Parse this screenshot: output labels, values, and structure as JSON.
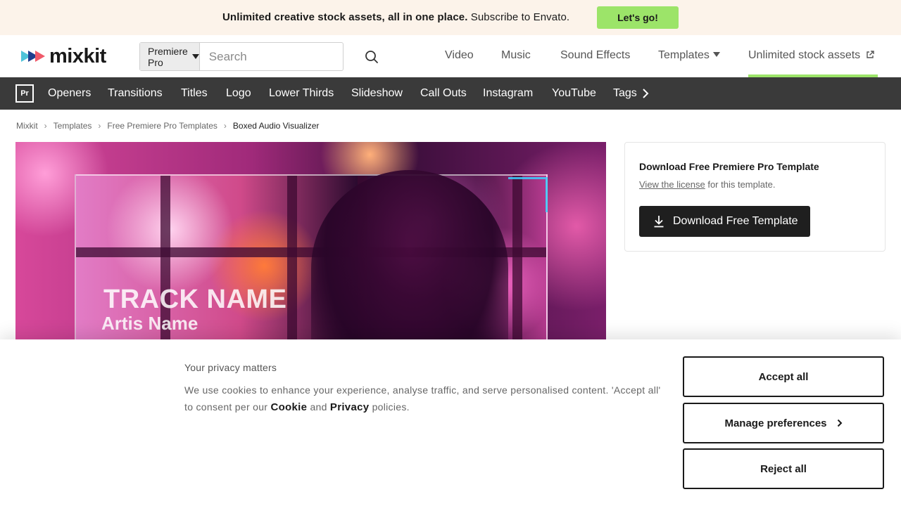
{
  "promo": {
    "bold_text": "Unlimited creative stock assets, all in one place.",
    "text": " Subscribe to Envato.",
    "button_label": "Let's go!"
  },
  "header": {
    "logo_text": "mixkit",
    "search": {
      "category_selected": "Premiere Pro",
      "placeholder": "Search"
    },
    "nav": {
      "video": "Video",
      "music": "Music",
      "sound_effects": "Sound Effects",
      "templates": "Templates",
      "unlimited": "Unlimited stock assets"
    },
    "accent_color": "#9ce469"
  },
  "category_bar": {
    "badge": "Pr",
    "items": [
      "Openers",
      "Transitions",
      "Titles",
      "Logo",
      "Lower Thirds",
      "Slideshow",
      "Call Outs",
      "Instagram",
      "YouTube",
      "Tags"
    ]
  },
  "breadcrumb": {
    "items": [
      "Mixkit",
      "Templates",
      "Free Premiere Pro Templates"
    ],
    "current": "Boxed Audio Visualizer"
  },
  "preview": {
    "track_name": "TRACK NAME",
    "artist_name": "Artis Name"
  },
  "download_card": {
    "title": "Download Free Premiere Pro Template",
    "license_link": "View the license",
    "license_suffix": " for this template.",
    "button_label": "Download Free Template"
  },
  "cookie_banner": {
    "title": "Your privacy matters",
    "body_prefix": "We use cookies to enhance your experience, analyse traffic, and serve personalised content. 'Accept all' to consent per our ",
    "cookie_link": "Cookie",
    "and": " and ",
    "privacy_link": "Privacy",
    "body_suffix": " policies.",
    "accept_label": "Accept all",
    "manage_label": "Manage preferences",
    "reject_label": "Reject all"
  }
}
